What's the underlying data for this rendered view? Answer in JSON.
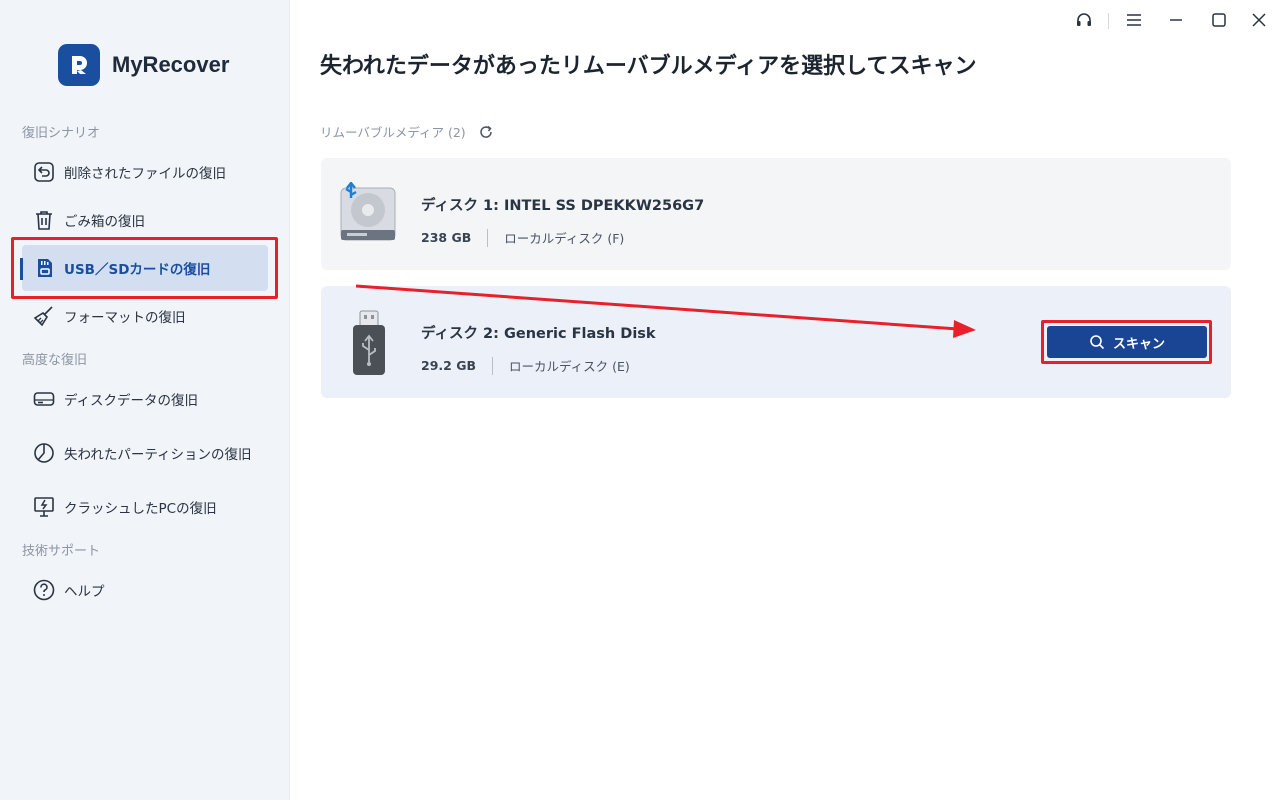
{
  "app": {
    "name": "MyRecover"
  },
  "window_controls": [
    "headset-icon",
    "menu-icon",
    "minimize-icon",
    "maximize-icon",
    "close-icon"
  ],
  "sidebar": {
    "sections": [
      {
        "title": "復旧シナリオ"
      },
      {
        "title": "高度な復旧"
      },
      {
        "title": "技術サポート"
      }
    ],
    "items": [
      {
        "label": "削除されたファイルの復旧",
        "icon": "undo-file-icon"
      },
      {
        "label": "ごみ箱の復旧",
        "icon": "trash-icon"
      },
      {
        "label": "USB／SDカードの復旧",
        "icon": "sd-card-icon",
        "active": true
      },
      {
        "label": "フォーマットの復旧",
        "icon": "broom-icon"
      },
      {
        "label": "ディスクデータの復旧",
        "icon": "drive-icon"
      },
      {
        "label": "失われたパーティションの復旧",
        "icon": "partition-icon"
      },
      {
        "label": "クラッシュしたPCの復旧",
        "icon": "crashed-pc-icon"
      },
      {
        "label": "ヘルプ",
        "icon": "help-icon"
      }
    ]
  },
  "main": {
    "title": "失われたデータがあったリムーバブルメディアを選択してスキャン",
    "section_label": "リムーバブルメディア (2)",
    "disks": [
      {
        "name": "ディスク 1: INTEL SS DPEKKW256G7",
        "size": "238 GB",
        "type": "ローカルディスク (F)",
        "icon": "usb-hdd-icon"
      },
      {
        "name": "ディスク 2: Generic  Flash Disk",
        "size": "29.2 GB",
        "type": "ローカルディスク (E)",
        "icon": "usb-flash-drive-icon"
      }
    ],
    "scan_button_label": "スキャン"
  },
  "colors": {
    "accent": "#1a4594",
    "highlight": "#e8202a",
    "sidebar_bg": "#f1f4f9",
    "active_item_bg": "#d3dff0"
  }
}
